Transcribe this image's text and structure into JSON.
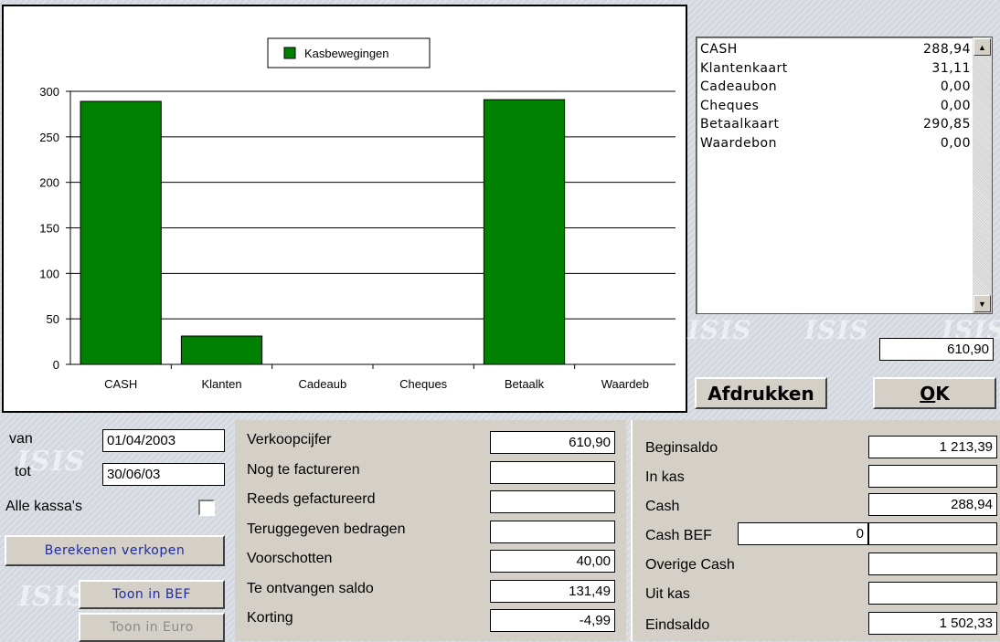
{
  "chart_data": {
    "type": "bar",
    "legend": "Kasbewegingen",
    "legend_position": "top",
    "categories": [
      "CASH",
      "Klanten",
      "Cadeaub",
      "Cheques",
      "Betaalk",
      "Waardeb"
    ],
    "values": [
      288.94,
      31.11,
      0,
      0,
      290.85,
      0
    ],
    "ylim": [
      0,
      300
    ],
    "yticks": [
      "0",
      "50",
      "100",
      "150",
      "200",
      "250",
      "300"
    ],
    "grid": true,
    "bar_color": "#008000"
  },
  "listbox": {
    "items": [
      {
        "name": "CASH",
        "value": "288,94"
      },
      {
        "name": "Klantenkaart",
        "value": "31,11"
      },
      {
        "name": "Cadeaubon",
        "value": "0,00"
      },
      {
        "name": "Cheques",
        "value": "0,00"
      },
      {
        "name": "Betaalkaart",
        "value": "290,85"
      },
      {
        "name": "Waardebon",
        "value": "0,00"
      }
    ],
    "total": "610,90"
  },
  "watermark": "ISIS",
  "buttons": {
    "print": "Afdrukken",
    "ok_prefix": "O",
    "ok_rest": "K",
    "calculate": "Berekenen verkopen",
    "show_bef": "Toon in BEF",
    "show_euro": "Toon in Euro"
  },
  "period": {
    "from_label": "van",
    "from_value": "01/04/2003",
    "to_label": "tot",
    "to_value": "30/06/03",
    "all_registers_label": "Alle kassa's"
  },
  "sales": {
    "rows": [
      {
        "label": "Verkoopcijfer",
        "value": "610,90"
      },
      {
        "label": "Nog te factureren",
        "value": ""
      },
      {
        "label": "Reeds gefactureerd",
        "value": ""
      },
      {
        "label": "Teruggegeven bedragen",
        "value": ""
      },
      {
        "label": "Voorschotten",
        "value": "40,00"
      },
      {
        "label": "Te ontvangen saldo",
        "value": "131,49"
      },
      {
        "label": "Korting",
        "value": "-4,99"
      }
    ]
  },
  "balance": {
    "begin_label": "Beginsaldo",
    "begin_value": "1 213,39",
    "in_label": "In kas",
    "in_value": "",
    "cash_label": "Cash",
    "cash_value": "288,94",
    "cashbef_label": "Cash BEF",
    "cashbef_input": "0",
    "cashbef_value": "",
    "other_label": "Overige Cash",
    "other_value": "",
    "out_label": "Uit kas",
    "out_value": "",
    "end_label": "Eindsaldo",
    "end_value": "1 502,33"
  }
}
